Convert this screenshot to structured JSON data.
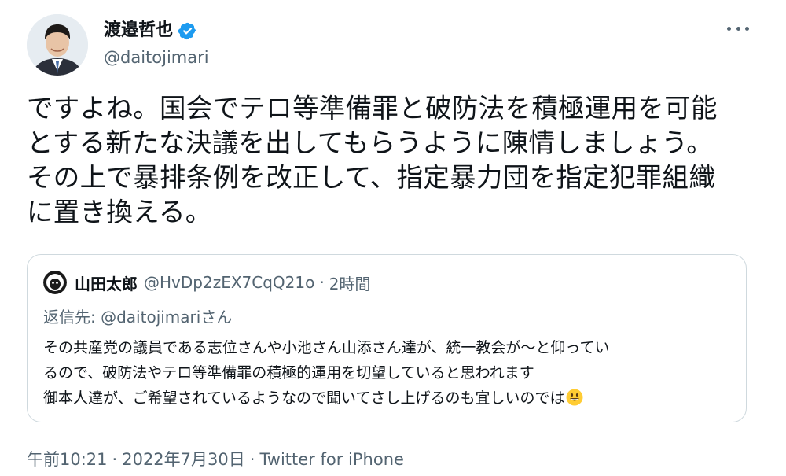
{
  "author": {
    "display_name": "渡邉哲也",
    "handle": "@daitojimari",
    "verified_icon": "verified-badge-icon",
    "more_icon": "more-options-icon"
  },
  "tweet": {
    "lines": [
      "ですよね。国会でテロ等準備罪と破防法を積極運用を可能",
      "とする新たな決議を出してもらうように陳情しましょう。",
      "その上で暴排条例を改正して、指定暴力団を指定犯罪組織",
      "に置き換える。"
    ]
  },
  "quoted_tweet": {
    "display_name": "山田太郎",
    "handle": "@HvDp2zEX7CqQ21o",
    "separator": "·",
    "time": "2時間",
    "reply_prefix": "返信先: ",
    "reply_handle": "@daitojimari",
    "reply_suffix": "さん",
    "lines": [
      "その共産党の議員である志位さんや小池さん山添さん達が、統一教会が〜と仰ってい",
      "るので、破防法やテロ等準備罪の積極的運用を切望していると思われます",
      "御本人達が、ご希望されているようなので聞いてさし上げるのも宜しいのでは"
    ],
    "emoji": "grinning-face-emoji"
  },
  "meta": {
    "time": "午前10:21",
    "separator": "·",
    "date": "2022年7月30日",
    "source": "Twitter for iPhone"
  },
  "colors": {
    "text": "#0f1419",
    "secondary": "#536471",
    "border": "#cfd9de",
    "verified": "#1d9bf0"
  }
}
